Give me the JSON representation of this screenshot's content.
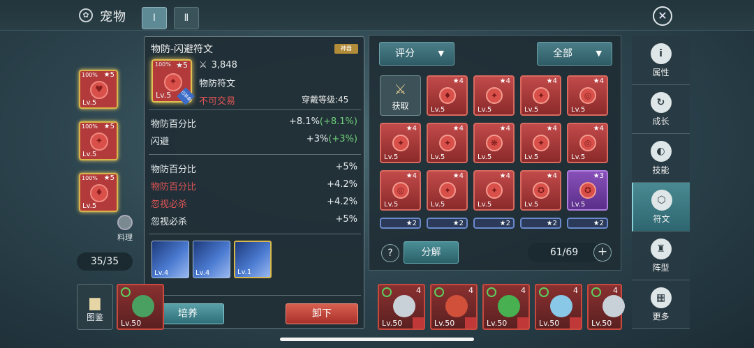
{
  "header": {
    "title": "宠物",
    "tabs": [
      "Ⅰ",
      "Ⅱ"
    ],
    "gear_glyph": "✿",
    "close_glyph": "✕"
  },
  "left": {
    "slots": [
      {
        "pct": "100%",
        "stars": "★5",
        "level": "Lv.5",
        "glyph": "♥"
      },
      {
        "pct": "100%",
        "stars": "★5",
        "level": "Lv.5",
        "glyph": "✦"
      },
      {
        "pct": "100%",
        "stars": "★5",
        "level": "Lv.5",
        "glyph": "♦"
      }
    ],
    "cook_label": "料理",
    "counter": "35/35"
  },
  "popup": {
    "name": "物防-闪避符文",
    "badge": "神器",
    "item": {
      "pct": "100%",
      "stars": "★5",
      "level": "Lv.5",
      "glyph": "✦",
      "equipped_tag": "已装备"
    },
    "power_icon": "crossed-swords-icon",
    "power": "3,848",
    "type": "物防符文",
    "trade": "不可交易",
    "wear_level": "穿戴等级:45",
    "main_stats": [
      {
        "name": "物防百分比",
        "value": "+8.1%",
        "bonus": "(+8.1%)"
      },
      {
        "name": "闪避",
        "value": "+3%",
        "bonus": "(+3%)"
      }
    ],
    "sub_stats": [
      {
        "name": "物防百分比",
        "value": "+5%",
        "highlight": false
      },
      {
        "name": "物防百分比",
        "value": "+4.2%",
        "highlight": true
      },
      {
        "name": "忽视必杀",
        "value": "+4.2%",
        "highlight": true
      },
      {
        "name": "忽视必杀",
        "value": "+5%",
        "highlight": false
      }
    ],
    "skills": [
      {
        "level": "Lv.4"
      },
      {
        "level": "Lv.4"
      },
      {
        "level": "Lv.1"
      }
    ],
    "train_label": "培养",
    "unequip_label": "卸下"
  },
  "inventory": {
    "sort_label": "评分",
    "filter_label": "全部",
    "fetch_label": "获取",
    "runes": [
      {
        "stars": "★4",
        "level": "Lv.5",
        "glyph": "♦",
        "style": "red"
      },
      {
        "stars": "★4",
        "level": "Lv.5",
        "glyph": "✦",
        "style": "red"
      },
      {
        "stars": "★4",
        "level": "Lv.5",
        "glyph": "✦",
        "style": "red"
      },
      {
        "stars": "★4",
        "level": "Lv.5",
        "glyph": "◎",
        "style": "red"
      },
      {
        "stars": "★4",
        "level": "Lv.5",
        "glyph": "✦",
        "style": "red"
      },
      {
        "stars": "★4",
        "level": "Lv.5",
        "glyph": "✦",
        "style": "red"
      },
      {
        "stars": "★4",
        "level": "Lv.5",
        "glyph": "❋",
        "style": "red"
      },
      {
        "stars": "★4",
        "level": "Lv.5",
        "glyph": "✦",
        "style": "red"
      },
      {
        "stars": "★4",
        "level": "Lv.5",
        "glyph": "◎",
        "style": "red"
      },
      {
        "stars": "★4",
        "level": "Lv.5",
        "glyph": "◎",
        "style": "red"
      },
      {
        "stars": "★4",
        "level": "Lv.5",
        "glyph": "✦",
        "style": "red"
      },
      {
        "stars": "★4",
        "level": "Lv.5",
        "glyph": "✦",
        "style": "red"
      },
      {
        "stars": "★4",
        "level": "Lv.5",
        "glyph": "✪",
        "style": "red"
      },
      {
        "stars": "★3",
        "level": "Lv.5",
        "glyph": "✪",
        "style": "purple"
      }
    ],
    "partial_row": [
      "★2",
      "★2",
      "★2",
      "★2",
      "★2"
    ],
    "help_glyph": "?",
    "decompose_label": "分解",
    "capacity": "61/69",
    "plus_glyph": "+"
  },
  "side_menu": [
    {
      "label": "属性",
      "glyph": "i",
      "active": false
    },
    {
      "label": "成长",
      "glyph": "↻",
      "active": false
    },
    {
      "label": "技能",
      "glyph": "◐",
      "active": false
    },
    {
      "label": "符文",
      "glyph": "⬡",
      "active": true
    },
    {
      "label": "阵型",
      "glyph": "♜",
      "active": false
    },
    {
      "label": "更多",
      "glyph": "▦",
      "active": false
    }
  ],
  "bottom": {
    "codex_label": "图鉴",
    "pets": [
      {
        "level": "Lv.50",
        "stars": "",
        "color": "#4aa060"
      },
      {
        "level": "Lv.50",
        "stars": "4",
        "color": "#c8d0d8"
      },
      {
        "level": "Lv.50",
        "stars": "4",
        "color": "#d0503a"
      },
      {
        "level": "Lv.50",
        "stars": "4",
        "color": "#48b050"
      },
      {
        "level": "Lv.50",
        "stars": "4",
        "color": "#8ac8e8"
      },
      {
        "level": "Lv.50",
        "stars": "4",
        "color": "#c8d0d8"
      }
    ]
  }
}
